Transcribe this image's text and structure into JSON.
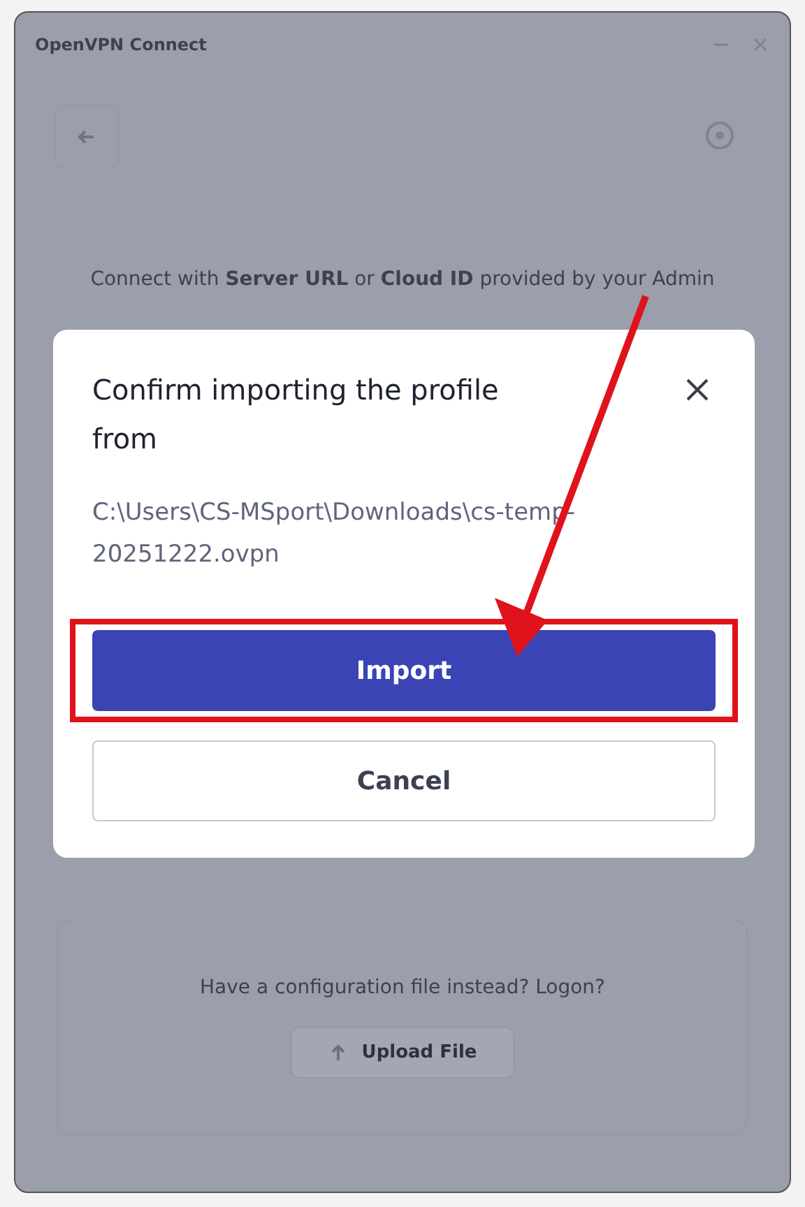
{
  "window": {
    "title": "OpenVPN Connect"
  },
  "background": {
    "intro": "Connect with **Server URL** or **Cloud ID** provided by your Admin",
    "file_prompt": "Have a configuration file instead? Logon?",
    "upload_button": "Upload File"
  },
  "dialog": {
    "title": "Confirm importing the profile from",
    "path": "C:\\Users\\CS-MSport\\Downloads\\cs-temp-20251222.ovpn",
    "buttons": [
      {
        "label": "Import",
        "kind": "primary",
        "highlighted": true
      },
      {
        "label": "Cancel",
        "kind": "secondary",
        "highlighted": false
      }
    ]
  }
}
